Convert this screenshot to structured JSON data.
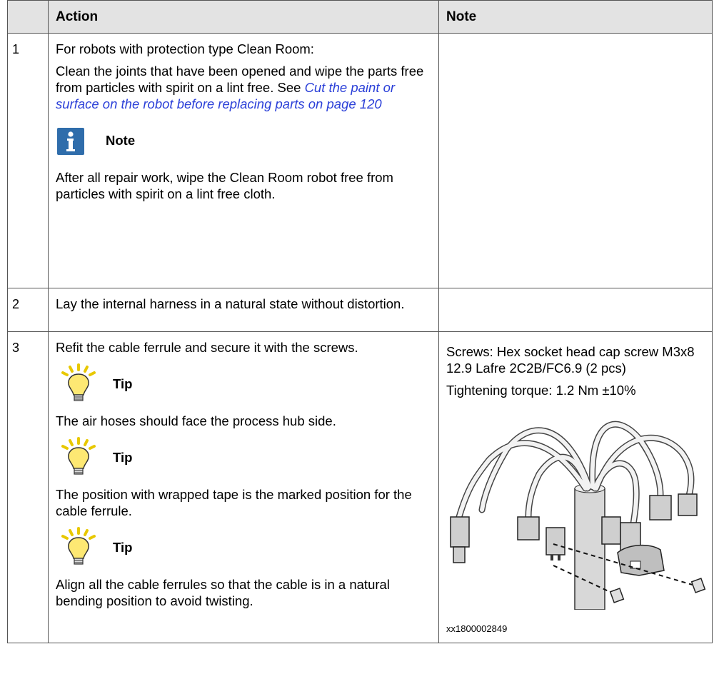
{
  "headers": {
    "col0": "",
    "action": "Action",
    "note": "Note"
  },
  "rows": [
    {
      "num": "1",
      "p1": "For robots with protection type Clean Room:",
      "p2_text": "Clean the joints that have been opened and wipe the parts free from particles with spirit on a lint free. See ",
      "p2_link": "Cut the paint or surface on the robot before replacing parts on page 120",
      "note_title": "Note",
      "note_text": "After all repair work, wipe the Clean Room robot free from particles with spirit on a lint free cloth."
    },
    {
      "num": "2",
      "text": "Lay the internal harness in a natural state without distortion."
    },
    {
      "num": "3",
      "text": "Refit the cable ferrule and secure it with the screws.",
      "tips": [
        {
          "title": "Tip",
          "text": "The air hoses should face the process hub side."
        },
        {
          "title": "Tip",
          "text": "The position with wrapped tape is the marked position for the cable ferrule."
        },
        {
          "title": "Tip",
          "text": "Align all the cable ferrules so that the cable is in a natural bending position to avoid twisting."
        }
      ],
      "note_screws": "Screws: Hex socket head cap screw M3x8 12.9 Lafre 2C2B/FC6.9 (2 pcs)",
      "note_torque": "Tightening torque: 1.2 Nm ±10%",
      "figure_id": "xx1800002849"
    }
  ]
}
